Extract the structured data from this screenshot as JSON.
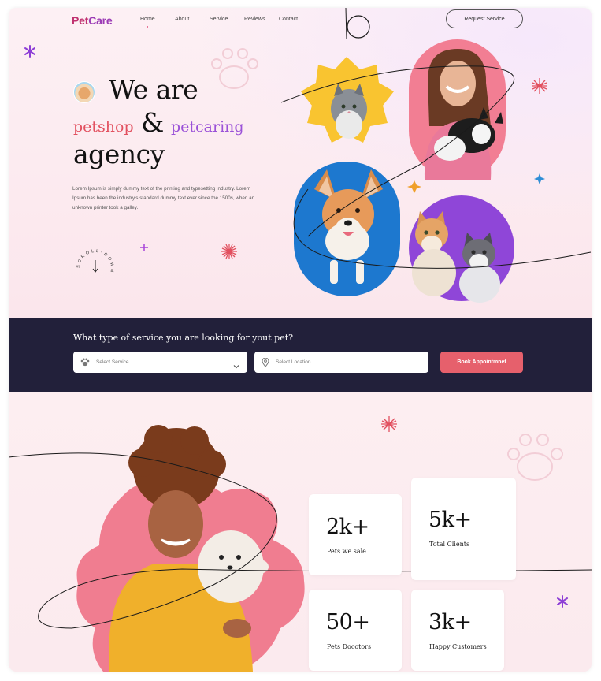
{
  "brand": {
    "name_a": "Pet",
    "name_b": "Care"
  },
  "nav": {
    "items": [
      "Home",
      "About",
      "Service",
      "Reviews",
      "Contact"
    ],
    "active": "Home"
  },
  "header": {
    "request_button": "Request Service"
  },
  "hero": {
    "line1": "We are",
    "word_a": "petshop",
    "amp": "&",
    "word_b": "petcaring",
    "line3": "agency",
    "description": "Lorem Ipsum is simply dummy text of the printing and typesetting industry. Lorem Ipsum has been the industry's standard dummy text ever since the 1500s, when an unknown printer took a galley.",
    "scroll_text": "SCROLL-DOWN"
  },
  "search": {
    "question": "What type of service you are looking for yout pet?",
    "service_placeholder": "Select Service",
    "location_placeholder": "Select Location",
    "book_button": "Book Appointmnet"
  },
  "stats": [
    {
      "value": "2k+",
      "label": "Pets we sale"
    },
    {
      "value": "5k+",
      "label": "Total Clients"
    },
    {
      "value": "50+",
      "label": "Pets Docotors"
    },
    {
      "value": "3k+",
      "label": "Happy Customers"
    }
  ],
  "colors": {
    "brand_pink": "#c0306f",
    "accent_red": "#e2505f",
    "accent_purple": "#9b52d8",
    "dark_band": "#22203a",
    "book_button": "#e6606c"
  },
  "icons": [
    "paw-icon",
    "location-pin-icon",
    "chevron-down-icon",
    "arrow-down-icon",
    "sparkle-icon",
    "star-icon"
  ]
}
